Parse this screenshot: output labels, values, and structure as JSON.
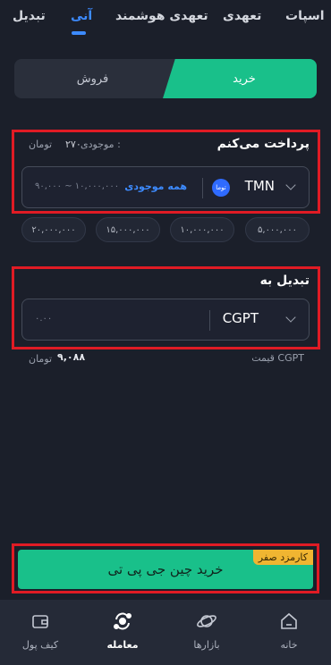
{
  "tabs": [
    {
      "label": "اسپات"
    },
    {
      "label": "تعهدی"
    },
    {
      "label": "تعهدی هوشمند"
    },
    {
      "label": "آنی",
      "active": true
    },
    {
      "label": "تبدیل"
    }
  ],
  "toggle": {
    "buy": "خرید",
    "sell": "فروش"
  },
  "pay": {
    "title": "پرداخت می‌کنم",
    "balance_label": "موجودی :",
    "balance_value": "۲۷۰",
    "balance_unit": "تومان",
    "currency": "TMN",
    "currency_badge": "توما",
    "all_balance": "همه موجودی",
    "placeholder": "۹۰,۰۰۰ ~ ۱۰,۰۰۰,۰۰۰"
  },
  "quick_amounts": [
    "۵,۰۰۰,۰۰۰",
    "۱۰,۰۰۰,۰۰۰",
    "۱۵,۰۰۰,۰۰۰",
    "۲۰,۰۰۰,۰۰۰"
  ],
  "convert": {
    "title": "تبدیل به",
    "currency": "CGPT",
    "placeholder": "۰.۰۰",
    "price_label": "قیمت CGPT",
    "price_value": "۹,۰۸۸",
    "price_unit": "تومان"
  },
  "cta": {
    "label": "خرید چین جی پی تی",
    "badge": "کارمزد صفر"
  },
  "colors": {
    "accent": "#19c08a",
    "active_tab": "#3d8bff",
    "badge": "#f0b531",
    "highlight": "#e01b24"
  },
  "nav": [
    {
      "label": "خانه",
      "icon": "home-icon"
    },
    {
      "label": "بازارها",
      "icon": "planet-icon"
    },
    {
      "label": "معامله",
      "icon": "exchange-icon",
      "active": true
    },
    {
      "label": "کیف پول",
      "icon": "wallet-icon"
    }
  ]
}
